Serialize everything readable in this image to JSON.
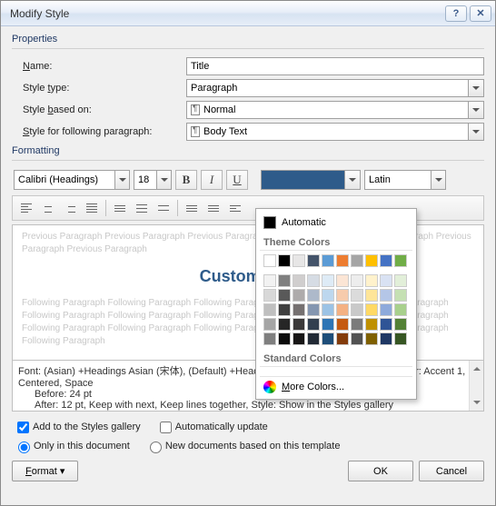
{
  "dialog": {
    "title": "Modify Style"
  },
  "sections": {
    "properties": "Properties",
    "formatting": "Formatting"
  },
  "labels": {
    "name": "Name:",
    "style_type": "Style type:",
    "based_on": "Style based on:",
    "following": "Style for following paragraph:"
  },
  "fields": {
    "name": "Title",
    "style_type": "Paragraph",
    "based_on": "Normal",
    "following": "Body Text"
  },
  "font": {
    "family": "Calibri (Headings)",
    "size": "18",
    "script": "Latin"
  },
  "buttons": {
    "bold": "B",
    "italic": "I",
    "underline": "U"
  },
  "preview": {
    "prev_line": "Previous Paragraph Previous Paragraph Previous Paragraph Previous Paragraph Previous Paragraph Previous Paragraph Previous Paragraph",
    "sample": "Custom Wor",
    "foll_line": "Following Paragraph Following Paragraph Following Paragraph Following Paragraph Following Paragraph Following Paragraph Following Paragraph Following Paragraph Following Paragraph Following Paragraph Following Paragraph Following Paragraph Following Paragraph Following Paragraph Following Paragraph Following Paragraph"
  },
  "description": {
    "line1": "Font: (Asian) +Headings Asian (宋体), (Default) +Headings (Calibri), 18 pt, Bold, Font color: Accent 1, Centered, Space",
    "line2": "Before:  24 pt",
    "line3": "After:  12 pt, Keep with next, Keep lines together, Style: Show in the Styles gallery"
  },
  "options": {
    "add_gallery": "Add to the Styles gallery",
    "auto_update": "Automatically update",
    "only_doc": "Only in this document",
    "new_docs": "New documents based on this template"
  },
  "footer": {
    "format": "Format ▾",
    "ok": "OK",
    "cancel": "Cancel"
  },
  "colormenu": {
    "automatic": "Automatic",
    "theme_head": "Theme Colors",
    "std_head": "Standard Colors",
    "more": "More Colors...",
    "theme_row": [
      "#ffffff",
      "#000000",
      "#e7e6e6",
      "#44546a",
      "#5b9bd5",
      "#ed7d31",
      "#a5a5a5",
      "#ffc000",
      "#4472c4",
      "#70ad47"
    ],
    "theme_shades": [
      [
        "#f2f2f2",
        "#7f7f7f",
        "#d0cece",
        "#d6dce4",
        "#deebf6",
        "#fbe5d5",
        "#ededed",
        "#fff2cc",
        "#d9e2f3",
        "#e2efd9"
      ],
      [
        "#d8d8d8",
        "#595959",
        "#aeabab",
        "#adb9ca",
        "#bdd7ee",
        "#f7cbac",
        "#dbdbdb",
        "#fee599",
        "#b4c6e7",
        "#c5e0b3"
      ],
      [
        "#bfbfbf",
        "#3f3f3f",
        "#757070",
        "#8496b0",
        "#9cc3e5",
        "#f4b183",
        "#c9c9c9",
        "#ffd965",
        "#8eaadb",
        "#a8d08d"
      ],
      [
        "#a5a5a5",
        "#262626",
        "#3a3838",
        "#323f4f",
        "#2e75b5",
        "#c55a11",
        "#7b7b7b",
        "#bf9000",
        "#2f5496",
        "#538135"
      ],
      [
        "#7f7f7f",
        "#0c0c0c",
        "#171616",
        "#222a35",
        "#1e4e79",
        "#833c0b",
        "#525252",
        "#7f6000",
        "#1f3864",
        "#375623"
      ]
    ],
    "standard": [
      "#c00000",
      "#ff0000",
      "#ffc000",
      "#ffff00",
      "#92d050",
      "#00b050",
      "#00b0f0",
      "#0070c0",
      "#002060",
      "#7030a0"
    ]
  }
}
